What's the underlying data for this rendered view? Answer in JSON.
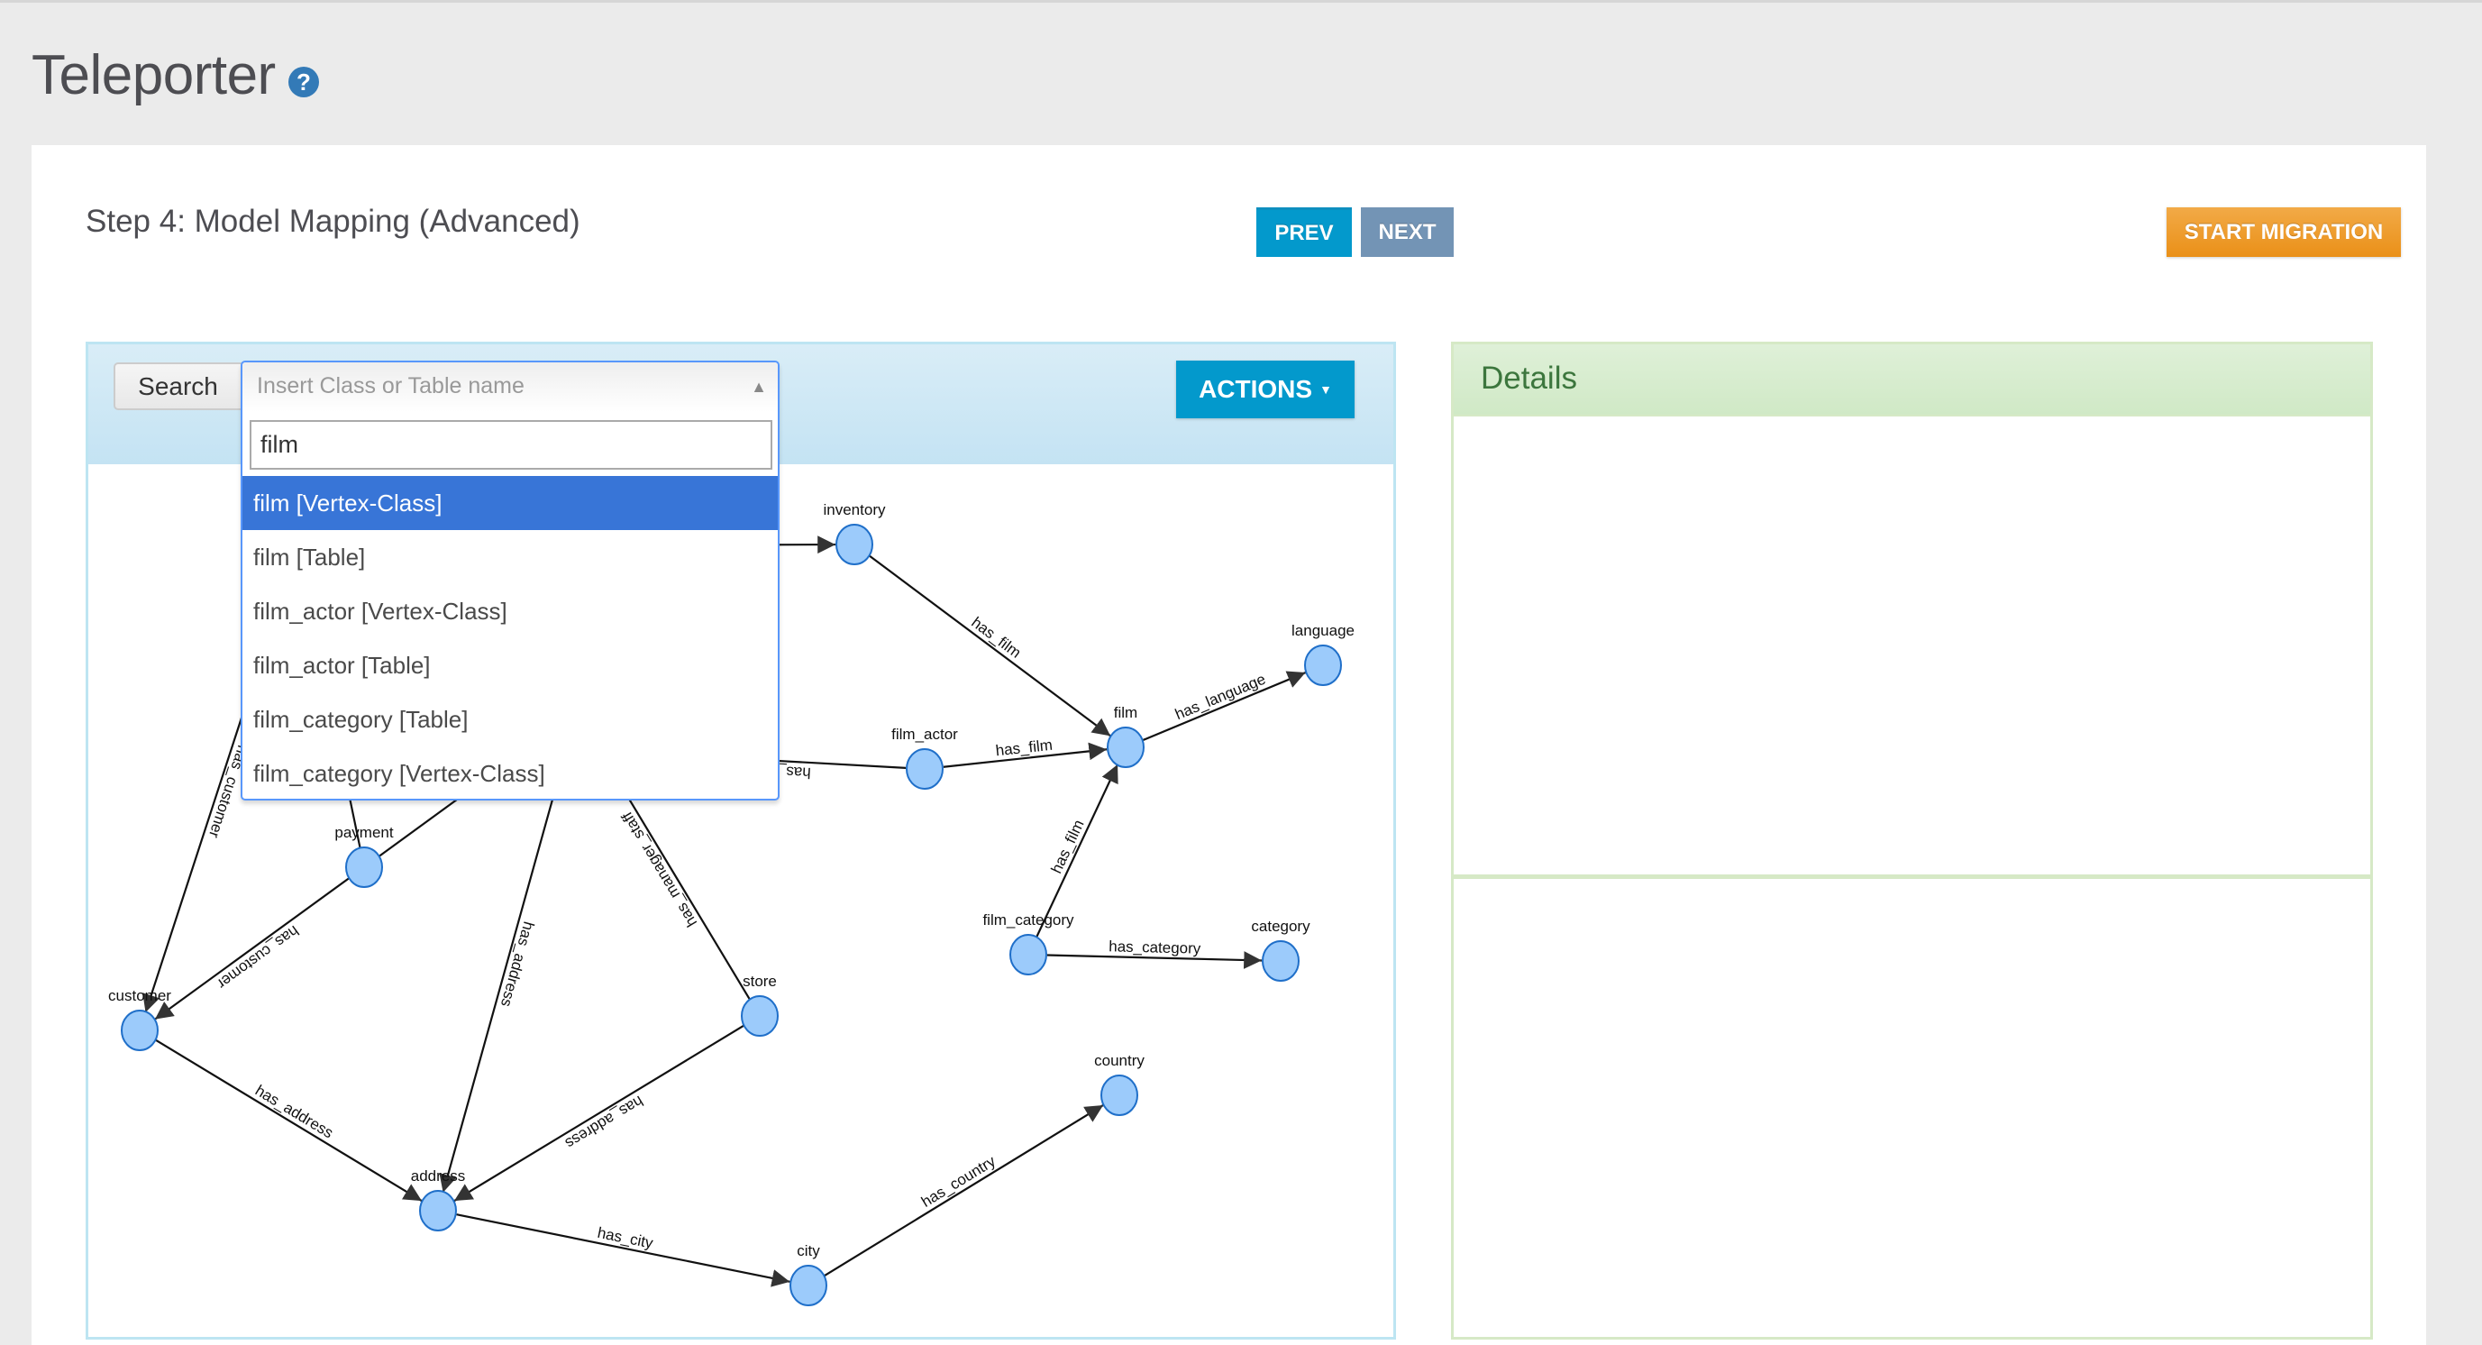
{
  "app": {
    "title": "Teleporter",
    "help_icon": "question-circle-icon"
  },
  "step": {
    "title": "Step 4: Model Mapping (Advanced)",
    "prev_label": "PREV",
    "next_label": "NEXT",
    "start_label": "START MIGRATION"
  },
  "graph_panel": {
    "search_label": "Search",
    "select_placeholder": "Insert Class or Table name",
    "search_value": "film",
    "actions_label": "ACTIONS",
    "options": [
      {
        "label": "film [Vertex-Class]",
        "active": true
      },
      {
        "label": "film [Table]",
        "active": false
      },
      {
        "label": "film_actor [Vertex-Class]",
        "active": false
      },
      {
        "label": "film_actor [Table]",
        "active": false
      },
      {
        "label": "film_category [Table]",
        "active": false
      },
      {
        "label": "film_category [Vertex-Class]",
        "active": false
      }
    ]
  },
  "graph": {
    "node_color": "#9ccbfb",
    "node_stroke": "#1f6fc9",
    "nodes": [
      {
        "id": "inventory",
        "label": "inventory"
      },
      {
        "id": "language",
        "label": "language"
      },
      {
        "id": "film",
        "label": "film"
      },
      {
        "id": "film_actor",
        "label": "film_actor"
      },
      {
        "id": "payment",
        "label": "payment"
      },
      {
        "id": "film_category",
        "label": "film_category"
      },
      {
        "id": "category",
        "label": "category"
      },
      {
        "id": "customer",
        "label": "customer"
      },
      {
        "id": "store",
        "label": "store"
      },
      {
        "id": "country",
        "label": "country"
      },
      {
        "id": "address",
        "label": "address"
      },
      {
        "id": "city",
        "label": "city"
      },
      {
        "id": "rental",
        "label": ""
      },
      {
        "id": "staff",
        "label": ""
      },
      {
        "id": "actor",
        "label": ""
      }
    ],
    "edges": [
      {
        "from": "rental",
        "to": "inventory",
        "label": ""
      },
      {
        "from": "inventory",
        "to": "film",
        "label": "has_film"
      },
      {
        "from": "film",
        "to": "language",
        "label": "has_language"
      },
      {
        "from": "film_actor",
        "to": "film",
        "label": "has_film"
      },
      {
        "from": "film_actor",
        "to": "actor",
        "label": "has_actor"
      },
      {
        "from": "film_category",
        "to": "film",
        "label": "has_film"
      },
      {
        "from": "film_category",
        "to": "category",
        "label": "has_category"
      },
      {
        "from": "rental",
        "to": "customer",
        "label": "has_customer"
      },
      {
        "from": "payment",
        "to": "customer",
        "label": "has_customer"
      },
      {
        "from": "payment",
        "to": "rental",
        "label": ""
      },
      {
        "from": "payment",
        "to": "staff",
        "label": ""
      },
      {
        "from": "staff",
        "to": "address",
        "label": "has_address"
      },
      {
        "from": "store",
        "to": "staff",
        "label": "has_manager_staff"
      },
      {
        "from": "customer",
        "to": "address",
        "label": "has_address"
      },
      {
        "from": "store",
        "to": "address",
        "label": "has_address"
      },
      {
        "from": "address",
        "to": "city",
        "label": "has_city"
      },
      {
        "from": "city",
        "to": "country",
        "label": "has_country"
      }
    ]
  },
  "details": {
    "title": "Details"
  }
}
